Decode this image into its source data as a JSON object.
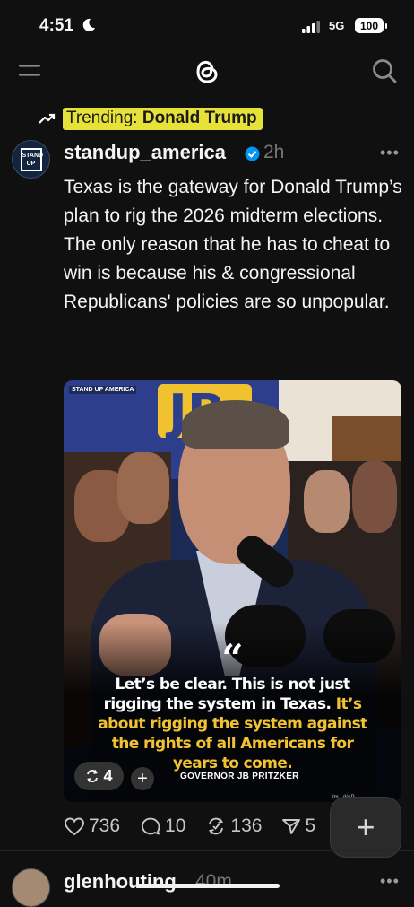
{
  "status_bar": {
    "time": "4:51",
    "network": "5G",
    "battery": "100"
  },
  "trending": {
    "prefix": "Trending: ",
    "topic": "Donald Trump",
    "highlight_color": "#e6e23a"
  },
  "post": {
    "avatar_text": "STAND UP",
    "username": "standup_america",
    "time": "2h",
    "verified": true,
    "text": "Texas is the gateway for Donald Trump’s plan to rig the 2026 midterm elections. The only reason that he has to cheat to win is because his & congressional Republicans' policies are so unpopular.",
    "media": {
      "watermark": "STAND UP AMERICA",
      "quote_mark": "“",
      "quote_white": "Let’s be clear. This is not just rigging the system in Texas.",
      "quote_yellow": " It’s about rigging the system against the rights of all Americans for years to come.",
      "quote_highlight_color": "#f1c232",
      "attribution": "GOVERNOR JB PRITZKER",
      "photo_credit": "Im...d/AP",
      "repost_count": "4",
      "plus": "+"
    },
    "actions": {
      "likes": "736",
      "replies": "10",
      "reposts": "136",
      "shares": "5"
    }
  },
  "compose": {
    "icon": "+"
  },
  "next_post": {
    "username": "glenhouting",
    "time": "40m"
  },
  "icons": [
    "menu-icon",
    "threads-logo-icon",
    "search-icon",
    "trend-icon",
    "verified-icon",
    "more-icon",
    "heart-icon",
    "reply-icon",
    "repost-icon",
    "share-icon",
    "plus-icon"
  ]
}
